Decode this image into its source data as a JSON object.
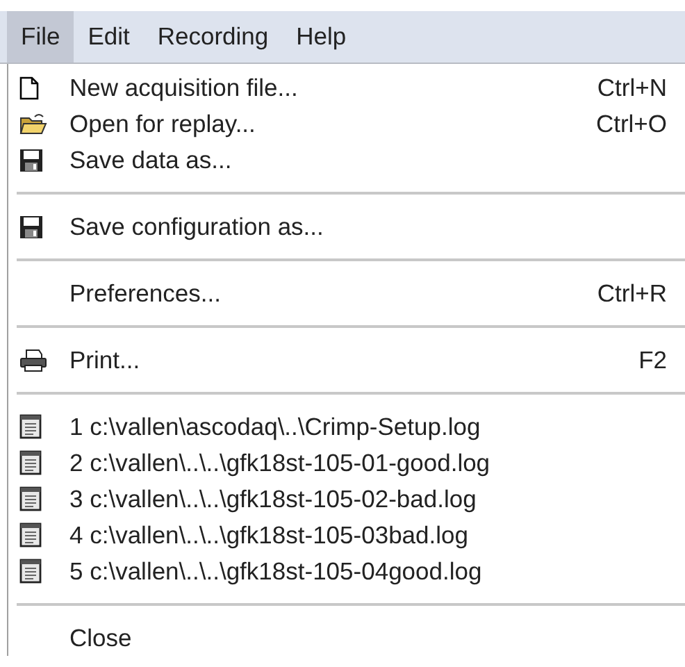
{
  "menubar": [
    {
      "label": "File",
      "selected": true
    },
    {
      "label": "Edit",
      "selected": false
    },
    {
      "label": "Recording",
      "selected": false
    },
    {
      "label": "Help",
      "selected": false
    }
  ],
  "menu": [
    {
      "kind": "page",
      "label": "New acquisition file...",
      "shortcut": "Ctrl+N"
    },
    {
      "kind": "folder",
      "label": "Open for replay...",
      "shortcut": "Ctrl+O"
    },
    {
      "kind": "disk",
      "label": "Save data as..."
    },
    {
      "kind": "separator"
    },
    {
      "kind": "disk",
      "label": "Save configuration as..."
    },
    {
      "kind": "separator"
    },
    {
      "kind": "plain",
      "label": "Preferences...",
      "shortcut": "Ctrl+R"
    },
    {
      "kind": "separator"
    },
    {
      "kind": "printer",
      "label": "Print...",
      "shortcut": "F2"
    },
    {
      "kind": "separator"
    },
    {
      "kind": "log",
      "label": "1 c:\\vallen\\ascodaq\\..\\Crimp-Setup.log"
    },
    {
      "kind": "log",
      "label": "2 c:\\vallen\\..\\..\\gfk18st-105-01-good.log"
    },
    {
      "kind": "log",
      "label": "3 c:\\vallen\\..\\..\\gfk18st-105-02-bad.log"
    },
    {
      "kind": "log",
      "label": "4 c:\\vallen\\..\\..\\gfk18st-105-03bad.log"
    },
    {
      "kind": "log",
      "label": "5 c:\\vallen\\..\\..\\gfk18st-105-04good.log"
    },
    {
      "kind": "separator"
    },
    {
      "kind": "plain",
      "label": "Close"
    }
  ]
}
